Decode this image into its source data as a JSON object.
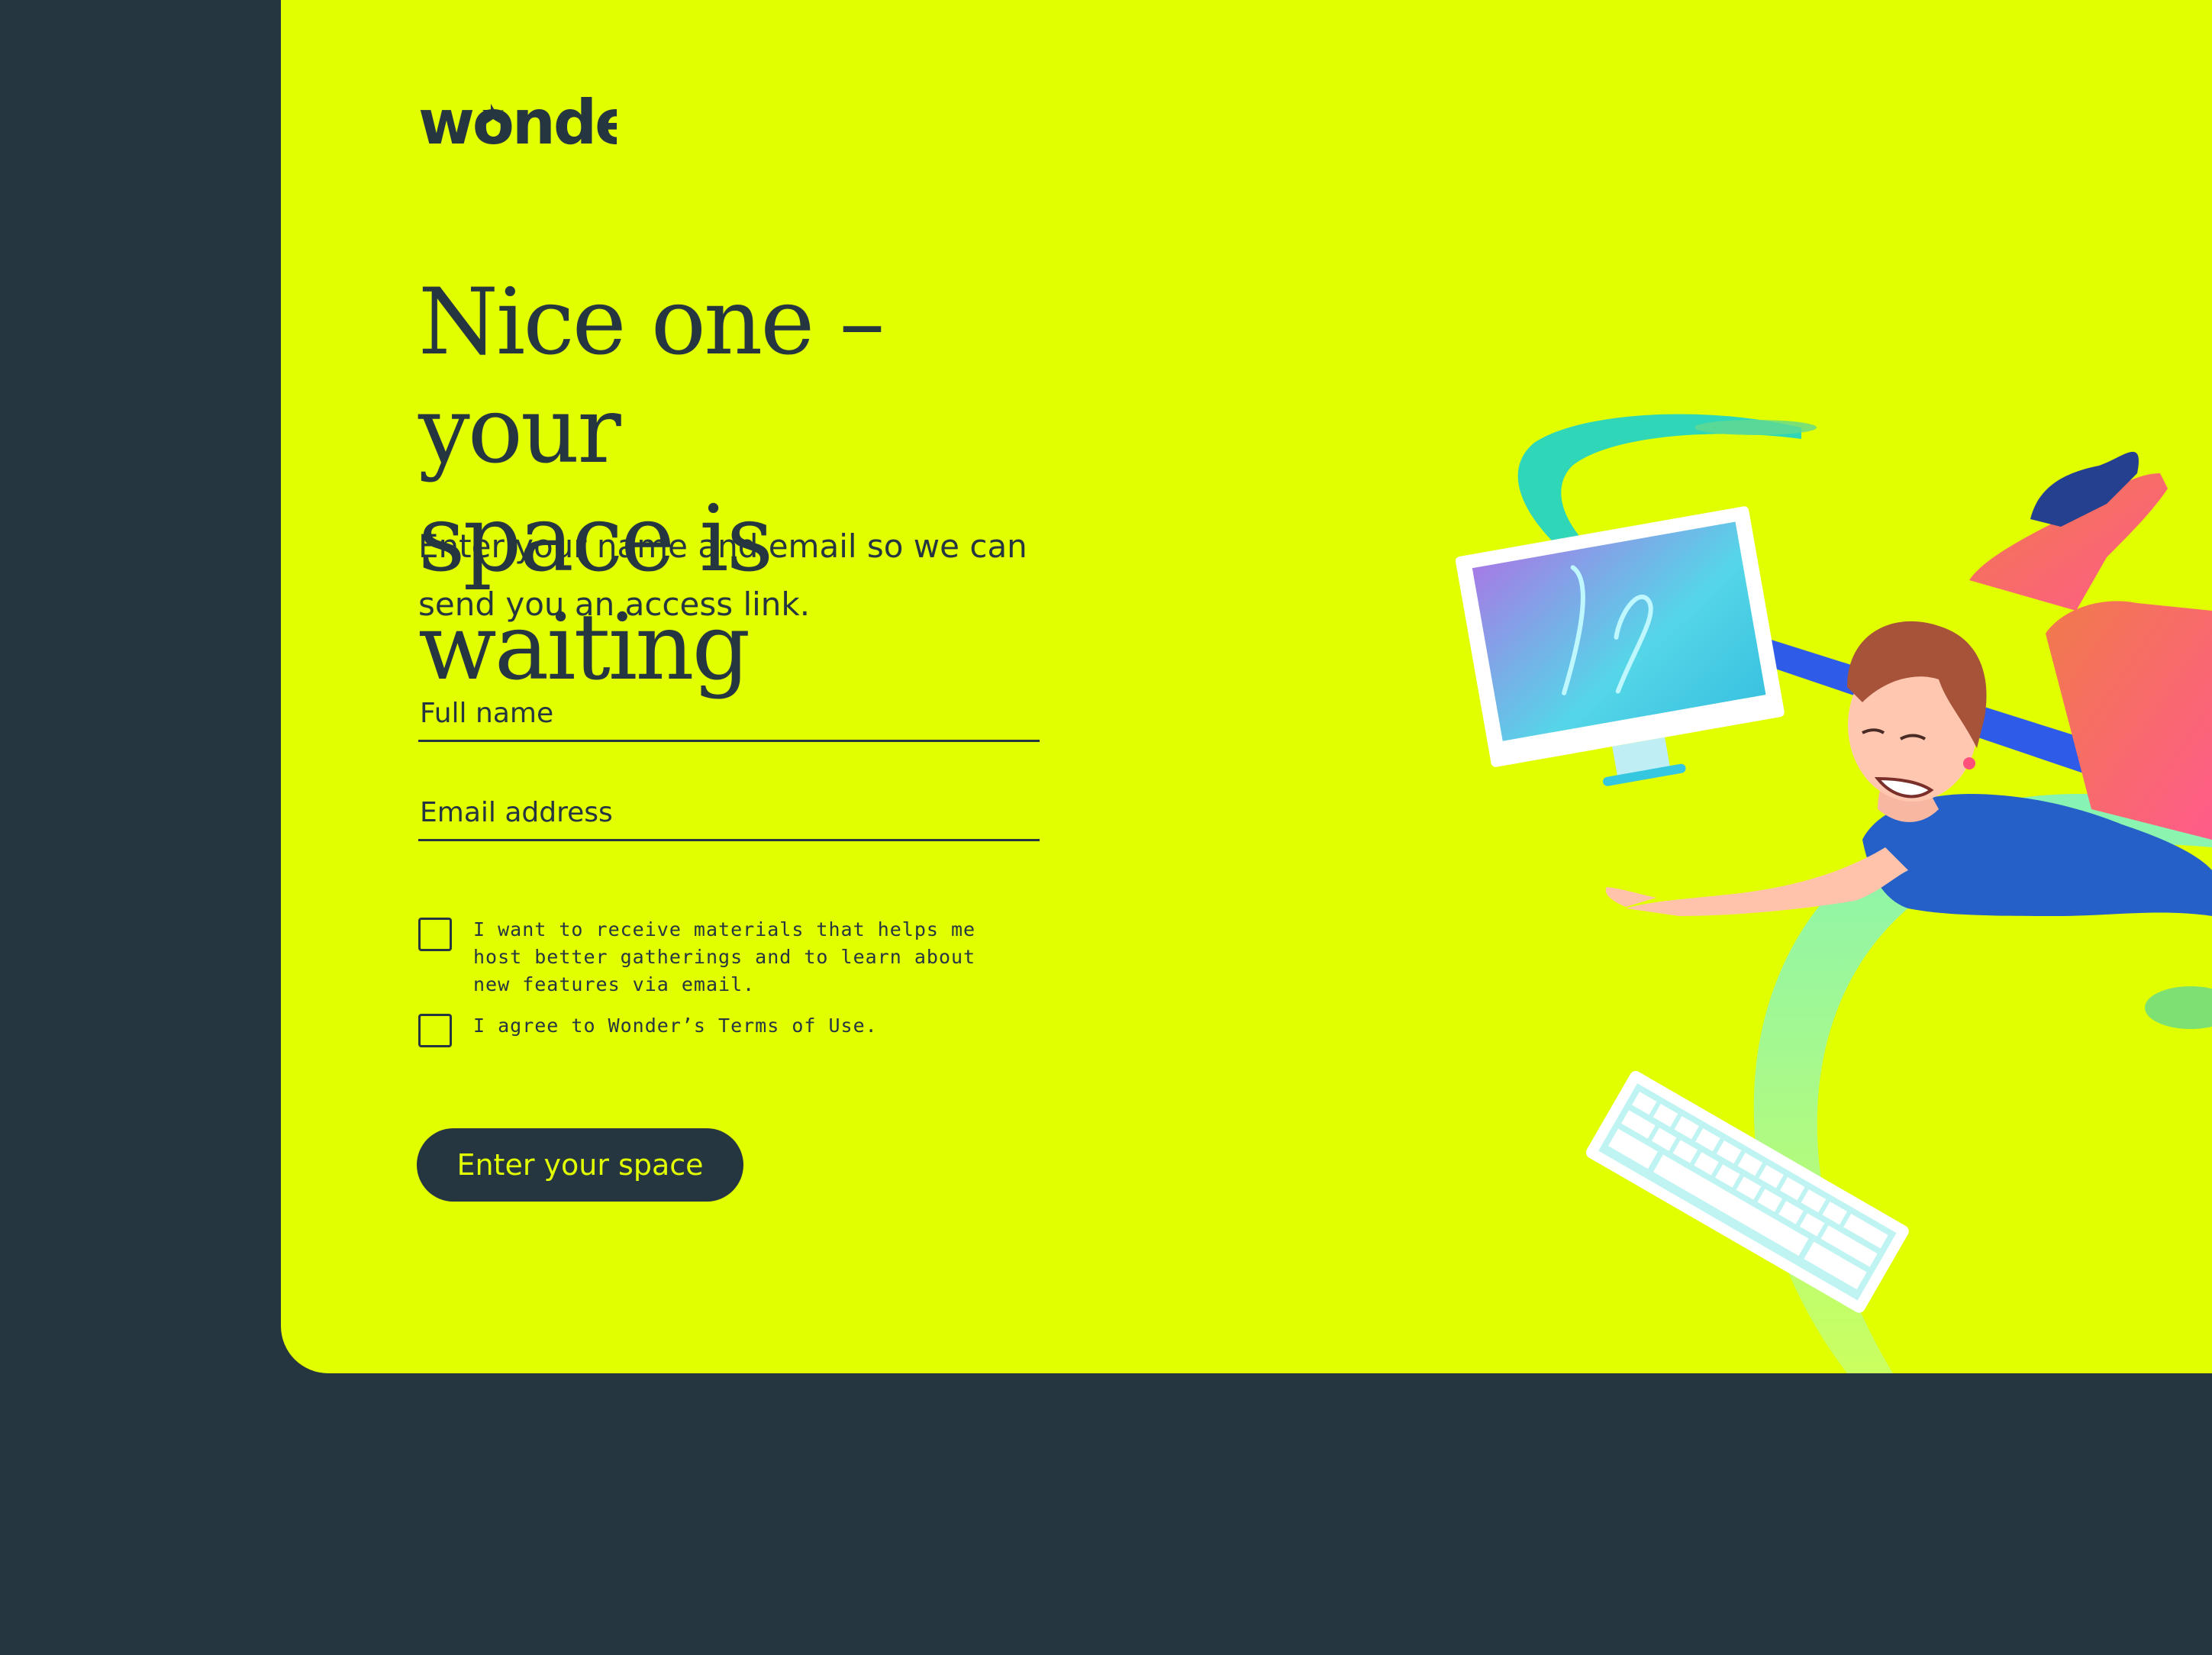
{
  "brand": {
    "logo_text": "wonder"
  },
  "headline": {
    "line1": "Nice one – your",
    "line2": "space is waiting"
  },
  "subtitle": "Enter your name and email so we can send you an access link.",
  "form": {
    "full_name_placeholder": "Full name",
    "email_placeholder": "Email address",
    "marketing_optin_label": "I want to receive materials that helps me host better gatherings and to learn about new features via email.",
    "terms_label": "I agree to Wonder’s Terms of Use.",
    "submit_label": "Enter your space"
  },
  "colors": {
    "background": "#253641",
    "card": "#E2FF00",
    "ink": "#253641",
    "button_text": "#E2FF00"
  },
  "icons": {
    "illustration": "person-floating-with-computer-illustration"
  }
}
